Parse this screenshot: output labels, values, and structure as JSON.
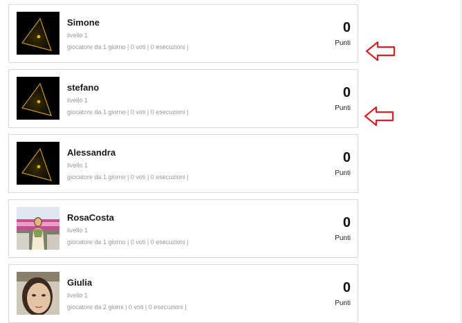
{
  "players": [
    {
      "name": "Simone",
      "level": "livello 1",
      "stats": "giocatore da 1 giorno | 0 voti | 0 esecuzioni |",
      "points": "0",
      "points_label": "Punti",
      "avatar": "default-triangle-avatar"
    },
    {
      "name": "stefano",
      "level": "livello 1",
      "stats": "giocatore da 1 giorno | 0 voti | 0 esecuzioni |",
      "points": "0",
      "points_label": "Punti",
      "avatar": "default-triangle-avatar"
    },
    {
      "name": "Alessandra",
      "level": "livello 1",
      "stats": "giocatore da 1 giorno | 0 voti | 0 esecuzioni |",
      "points": "0",
      "points_label": "Punti",
      "avatar": "default-triangle-avatar"
    },
    {
      "name": "RosaCosta",
      "level": "livello 1",
      "stats": "giocatore da 1 giorno | 0 voti | 0 esecuzioni |",
      "points": "0",
      "points_label": "Punti",
      "avatar": "photo-avatar-outdoor"
    },
    {
      "name": "Giulia",
      "level": "livello 1",
      "stats": "giocatore da 2 giorni | 0 voti | 0 esecuzioni |",
      "points": "0",
      "points_label": "Punti",
      "avatar": "photo-avatar-face"
    }
  ],
  "annotation": {
    "arrow_color": "#e01b24"
  },
  "colors": {
    "triangle_glow": "#e0b400",
    "card_border": "#d9d9d9"
  }
}
